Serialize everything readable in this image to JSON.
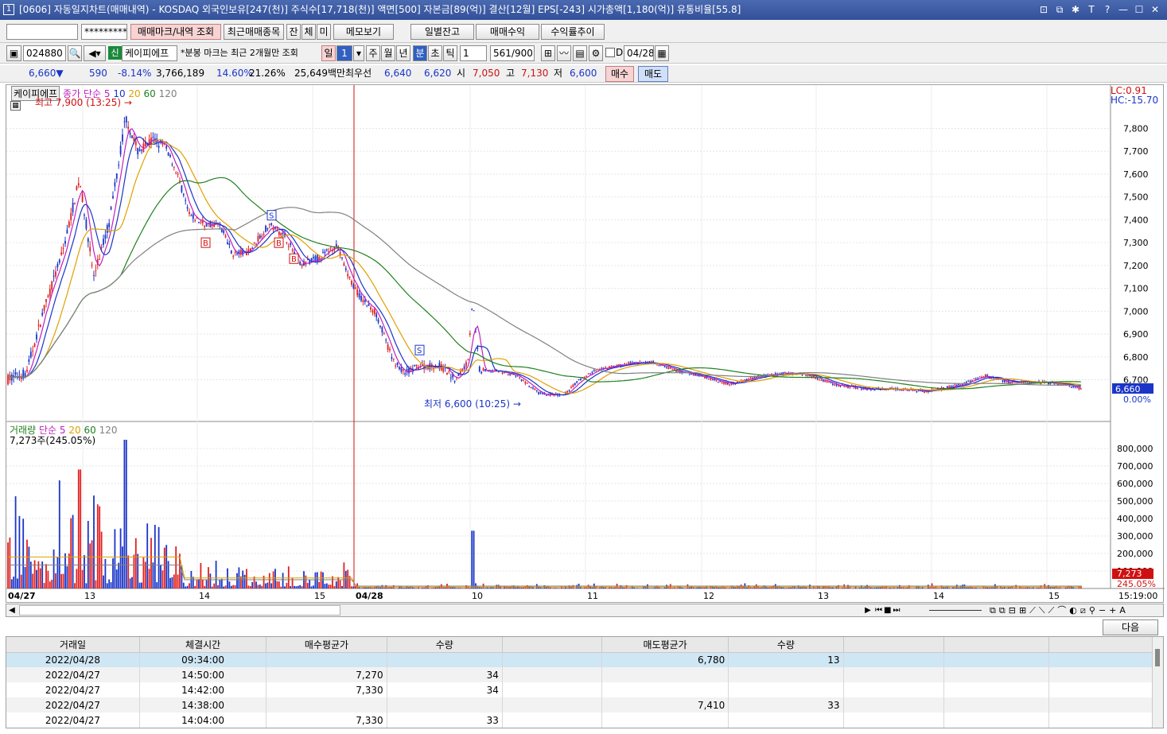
{
  "window": {
    "id": "1",
    "title": "[0606] 자동일지차트(매매내역) - KOSDAQ 외국인보유[247(천)] 주식수[17,718(천)] 액면[500] 자본금[89(억)] 결산[12월] EPS[-243] 시가총액[1,180(억)] 유통비율[55.8]"
  },
  "toolbar1": {
    "account": "",
    "password": "*********",
    "markers_btn": "매매마크/내역 조회",
    "recent_btn": "최근매매종목",
    "jan": "잔",
    "che": "체",
    "mi": "미",
    "memo_btn": "메모보기",
    "daily_btn": "일별잔고",
    "profit_btn": "매매수익",
    "returns_btn": "수익률추이"
  },
  "toolbar2": {
    "code": "024880",
    "badge": "신",
    "name": "케이피에프",
    "note": "*분봉 마크는 최근 2개월만 조회",
    "period_il": "일",
    "period_val": "1",
    "ju": "주",
    "wol": "월",
    "nyeon": "년",
    "bun": "분",
    "cho": "초",
    "tick": "틱",
    "interval": "1",
    "count": "561/900",
    "d_label": "D",
    "date": "04/28"
  },
  "quote": {
    "price": "6,660▼",
    "change": "590",
    "rate": "-8.14%",
    "volume": "3,766,189",
    "v1": "14.60%",
    "v2": "21.26%",
    "amount": "25,649백만",
    "best_label": "최우선",
    "best_sell": "6,640",
    "best_buy": "6,620",
    "open_label": "시",
    "open": "7,050",
    "high_label": "고",
    "high": "7,130",
    "low_label": "저",
    "low": "6,600",
    "buy_btn": "매수",
    "sell_btn": "매도"
  },
  "chart": {
    "price_legend": {
      "name": "케이피에프",
      "series": "종가 단순",
      "p5": "5",
      "p10": "10",
      "p20": "20",
      "p60": "60",
      "p120": "120"
    },
    "high_label": "최고 7,900 (13:25)",
    "low_label": "최저 6,600 (10:25)",
    "lc": "LC:0.91",
    "hc": "HC:-15.70",
    "price_ticks": [
      "7,800",
      "7,700",
      "7,600",
      "7,500",
      "7,400",
      "7,300",
      "7,200",
      "7,100",
      "7,000",
      "6,900",
      "6,800",
      "6,700",
      "6,660",
      "0.00%"
    ],
    "vol_legend": {
      "name": "거래량",
      "series": "단순",
      "p5": "5",
      "p20": "20",
      "p60": "60",
      "p120": "120",
      "last": "7,273주(245.05%)"
    },
    "vol_ticks": [
      "800,000",
      "700,000",
      "600,000",
      "500,000",
      "400,000",
      "300,000",
      "200,000",
      "100,000",
      "7,273",
      "245.05%"
    ],
    "x_labels": [
      "04/27",
      "13",
      "14",
      "15",
      "04/28",
      "10",
      "11",
      "12",
      "13",
      "14",
      "15"
    ],
    "time": "15:19:00",
    "markers": [
      "B",
      "S",
      "B",
      "B",
      "S"
    ],
    "colors": {
      "up": "#e02020",
      "down": "#1a35c8",
      "ma5": "#c020c0",
      "ma10": "#1a35c8",
      "ma20": "#e0a000",
      "ma60": "#208020",
      "ma120": "#808080"
    }
  },
  "next_btn": "다음",
  "table": {
    "headers": [
      "거래일",
      "체결시간",
      "매수평균가",
      "수량",
      "",
      "매도평균가",
      "수량",
      "",
      "",
      ""
    ],
    "rows": [
      [
        "2022/04/28",
        "09:34:00",
        "",
        "",
        "",
        "6,780",
        "13",
        "",
        "",
        ""
      ],
      [
        "2022/04/27",
        "14:50:00",
        "7,270",
        "34",
        "",
        "",
        "",
        "",
        "",
        ""
      ],
      [
        "2022/04/27",
        "14:42:00",
        "7,330",
        "34",
        "",
        "",
        "",
        "",
        "",
        ""
      ],
      [
        "2022/04/27",
        "14:38:00",
        "",
        "",
        "",
        "7,410",
        "33",
        "",
        "",
        ""
      ],
      [
        "2022/04/27",
        "14:04:00",
        "7,330",
        "33",
        "",
        "",
        "",
        "",
        "",
        ""
      ]
    ]
  }
}
